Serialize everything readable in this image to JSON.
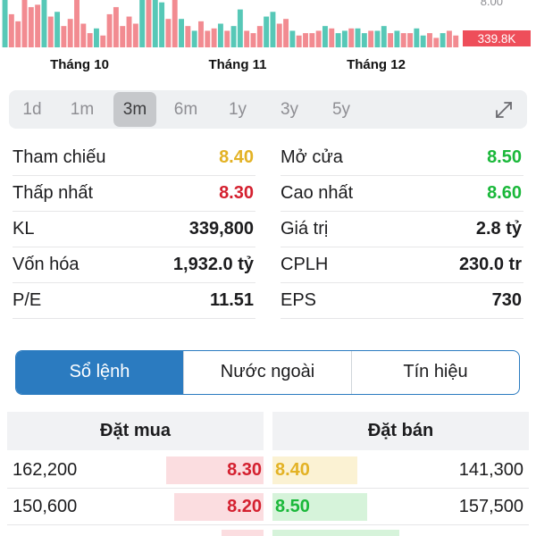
{
  "chart_data": {
    "type": "bar",
    "title": "",
    "price_axis_label": "8.00",
    "last_volume_label": "339.8K",
    "month_labels": [
      "Tháng 10",
      "Tháng 11",
      "Tháng 12"
    ],
    "colors": {
      "up": "#57c8b7",
      "down": "#f28b91",
      "last": "#ee4e5a"
    },
    "bars": [
      {
        "v": 1.0,
        "d": "up"
      },
      {
        "v": 0.7,
        "d": "down"
      },
      {
        "v": 0.55,
        "d": "down"
      },
      {
        "v": 1.0,
        "d": "down"
      },
      {
        "v": 0.85,
        "d": "down"
      },
      {
        "v": 0.9,
        "d": "down"
      },
      {
        "v": 1.0,
        "d": "up"
      },
      {
        "v": 0.65,
        "d": "down"
      },
      {
        "v": 0.75,
        "d": "up"
      },
      {
        "v": 0.45,
        "d": "down"
      },
      {
        "v": 0.6,
        "d": "down"
      },
      {
        "v": 1.0,
        "d": "down"
      },
      {
        "v": 0.5,
        "d": "down"
      },
      {
        "v": 0.3,
        "d": "down"
      },
      {
        "v": 0.4,
        "d": "up"
      },
      {
        "v": 0.25,
        "d": "down"
      },
      {
        "v": 0.7,
        "d": "down"
      },
      {
        "v": 0.85,
        "d": "down"
      },
      {
        "v": 0.45,
        "d": "down"
      },
      {
        "v": 0.65,
        "d": "down"
      },
      {
        "v": 0.5,
        "d": "down"
      },
      {
        "v": 1.0,
        "d": "up"
      },
      {
        "v": 1.0,
        "d": "down"
      },
      {
        "v": 1.0,
        "d": "up"
      },
      {
        "v": 0.95,
        "d": "up"
      },
      {
        "v": 0.6,
        "d": "down"
      },
      {
        "v": 1.0,
        "d": "down"
      },
      {
        "v": 0.6,
        "d": "up"
      },
      {
        "v": 0.45,
        "d": "down"
      },
      {
        "v": 0.35,
        "d": "up"
      },
      {
        "v": 0.55,
        "d": "down"
      },
      {
        "v": 0.35,
        "d": "down"
      },
      {
        "v": 0.4,
        "d": "down"
      },
      {
        "v": 0.5,
        "d": "up"
      },
      {
        "v": 0.35,
        "d": "down"
      },
      {
        "v": 0.45,
        "d": "up"
      },
      {
        "v": 0.8,
        "d": "up"
      },
      {
        "v": 0.35,
        "d": "down"
      },
      {
        "v": 0.3,
        "d": "down"
      },
      {
        "v": 0.45,
        "d": "down"
      },
      {
        "v": 0.65,
        "d": "up"
      },
      {
        "v": 0.75,
        "d": "up"
      },
      {
        "v": 0.5,
        "d": "down"
      },
      {
        "v": 0.6,
        "d": "down"
      },
      {
        "v": 0.35,
        "d": "up"
      },
      {
        "v": 0.25,
        "d": "down"
      },
      {
        "v": 0.3,
        "d": "down"
      },
      {
        "v": 0.3,
        "d": "down"
      },
      {
        "v": 0.35,
        "d": "down"
      },
      {
        "v": 0.45,
        "d": "up"
      },
      {
        "v": 0.4,
        "d": "down"
      },
      {
        "v": 0.3,
        "d": "up"
      },
      {
        "v": 0.35,
        "d": "up"
      },
      {
        "v": 0.4,
        "d": "down"
      },
      {
        "v": 0.4,
        "d": "up"
      },
      {
        "v": 0.3,
        "d": "up"
      },
      {
        "v": 0.35,
        "d": "down"
      },
      {
        "v": 0.35,
        "d": "up"
      },
      {
        "v": 0.45,
        "d": "up"
      },
      {
        "v": 0.3,
        "d": "down"
      },
      {
        "v": 0.35,
        "d": "up"
      },
      {
        "v": 0.3,
        "d": "down"
      },
      {
        "v": 0.3,
        "d": "down"
      },
      {
        "v": 0.4,
        "d": "up"
      },
      {
        "v": 0.25,
        "d": "up"
      },
      {
        "v": 0.3,
        "d": "down"
      },
      {
        "v": 0.2,
        "d": "down"
      },
      {
        "v": 0.3,
        "d": "up"
      },
      {
        "v": 0.35,
        "d": "down"
      },
      {
        "v": 0.25,
        "d": "down"
      }
    ]
  },
  "ranges": [
    "1d",
    "1m",
    "3m",
    "6m",
    "1y",
    "3y",
    "5y"
  ],
  "active_range": "3m",
  "expand_icon": "expand-icon",
  "stats": [
    {
      "label": "Tham chiếu",
      "value": "8.40",
      "color": "#e3b224"
    },
    {
      "label": "Mở cửa",
      "value": "8.50",
      "color": "#1ab83a"
    },
    {
      "label": "Thấp nhất",
      "value": "8.30",
      "color": "#d4202f"
    },
    {
      "label": "Cao nhất",
      "value": "8.60",
      "color": "#1ab83a"
    },
    {
      "label": "KL",
      "value": "339,800",
      "color": "#1c1c1e"
    },
    {
      "label": "Giá trị",
      "value": "2.8 tỷ",
      "color": "#1c1c1e"
    },
    {
      "label": "Vốn hóa",
      "value": "1,932.0 tỷ",
      "color": "#1c1c1e"
    },
    {
      "label": "CPLH",
      "value": "230.0 tr",
      "color": "#1c1c1e"
    },
    {
      "label": "P/E",
      "value": "11.51",
      "color": "#1c1c1e"
    },
    {
      "label": "EPS",
      "value": "730",
      "color": "#1c1c1e"
    }
  ],
  "tabs": [
    "Sổ lệnh",
    "Nước ngoài",
    "Tín hiệu"
  ],
  "active_tab": "Sổ lệnh",
  "orderbook": {
    "bid_header": "Đặt mua",
    "ask_header": "Đặt bán",
    "rows": [
      {
        "bid_vol": "162,200",
        "bid_price": "8.30",
        "bid_color": "#d4202f",
        "bid_fill": 0.38,
        "ask_price": "8.40",
        "ask_color": "#e3b224",
        "ask_bg": "#fbf2d3",
        "ask_fill": 0.33,
        "ask_vol": "141,300"
      },
      {
        "bid_vol": "150,600",
        "bid_price": "8.20",
        "bid_color": "#d4202f",
        "bid_fill": 0.35,
        "ask_price": "8.50",
        "ask_color": "#1ab83a",
        "ask_bg": "#d6f3da",
        "ask_fill": 0.37,
        "ask_vol": "157,500"
      }
    ]
  }
}
